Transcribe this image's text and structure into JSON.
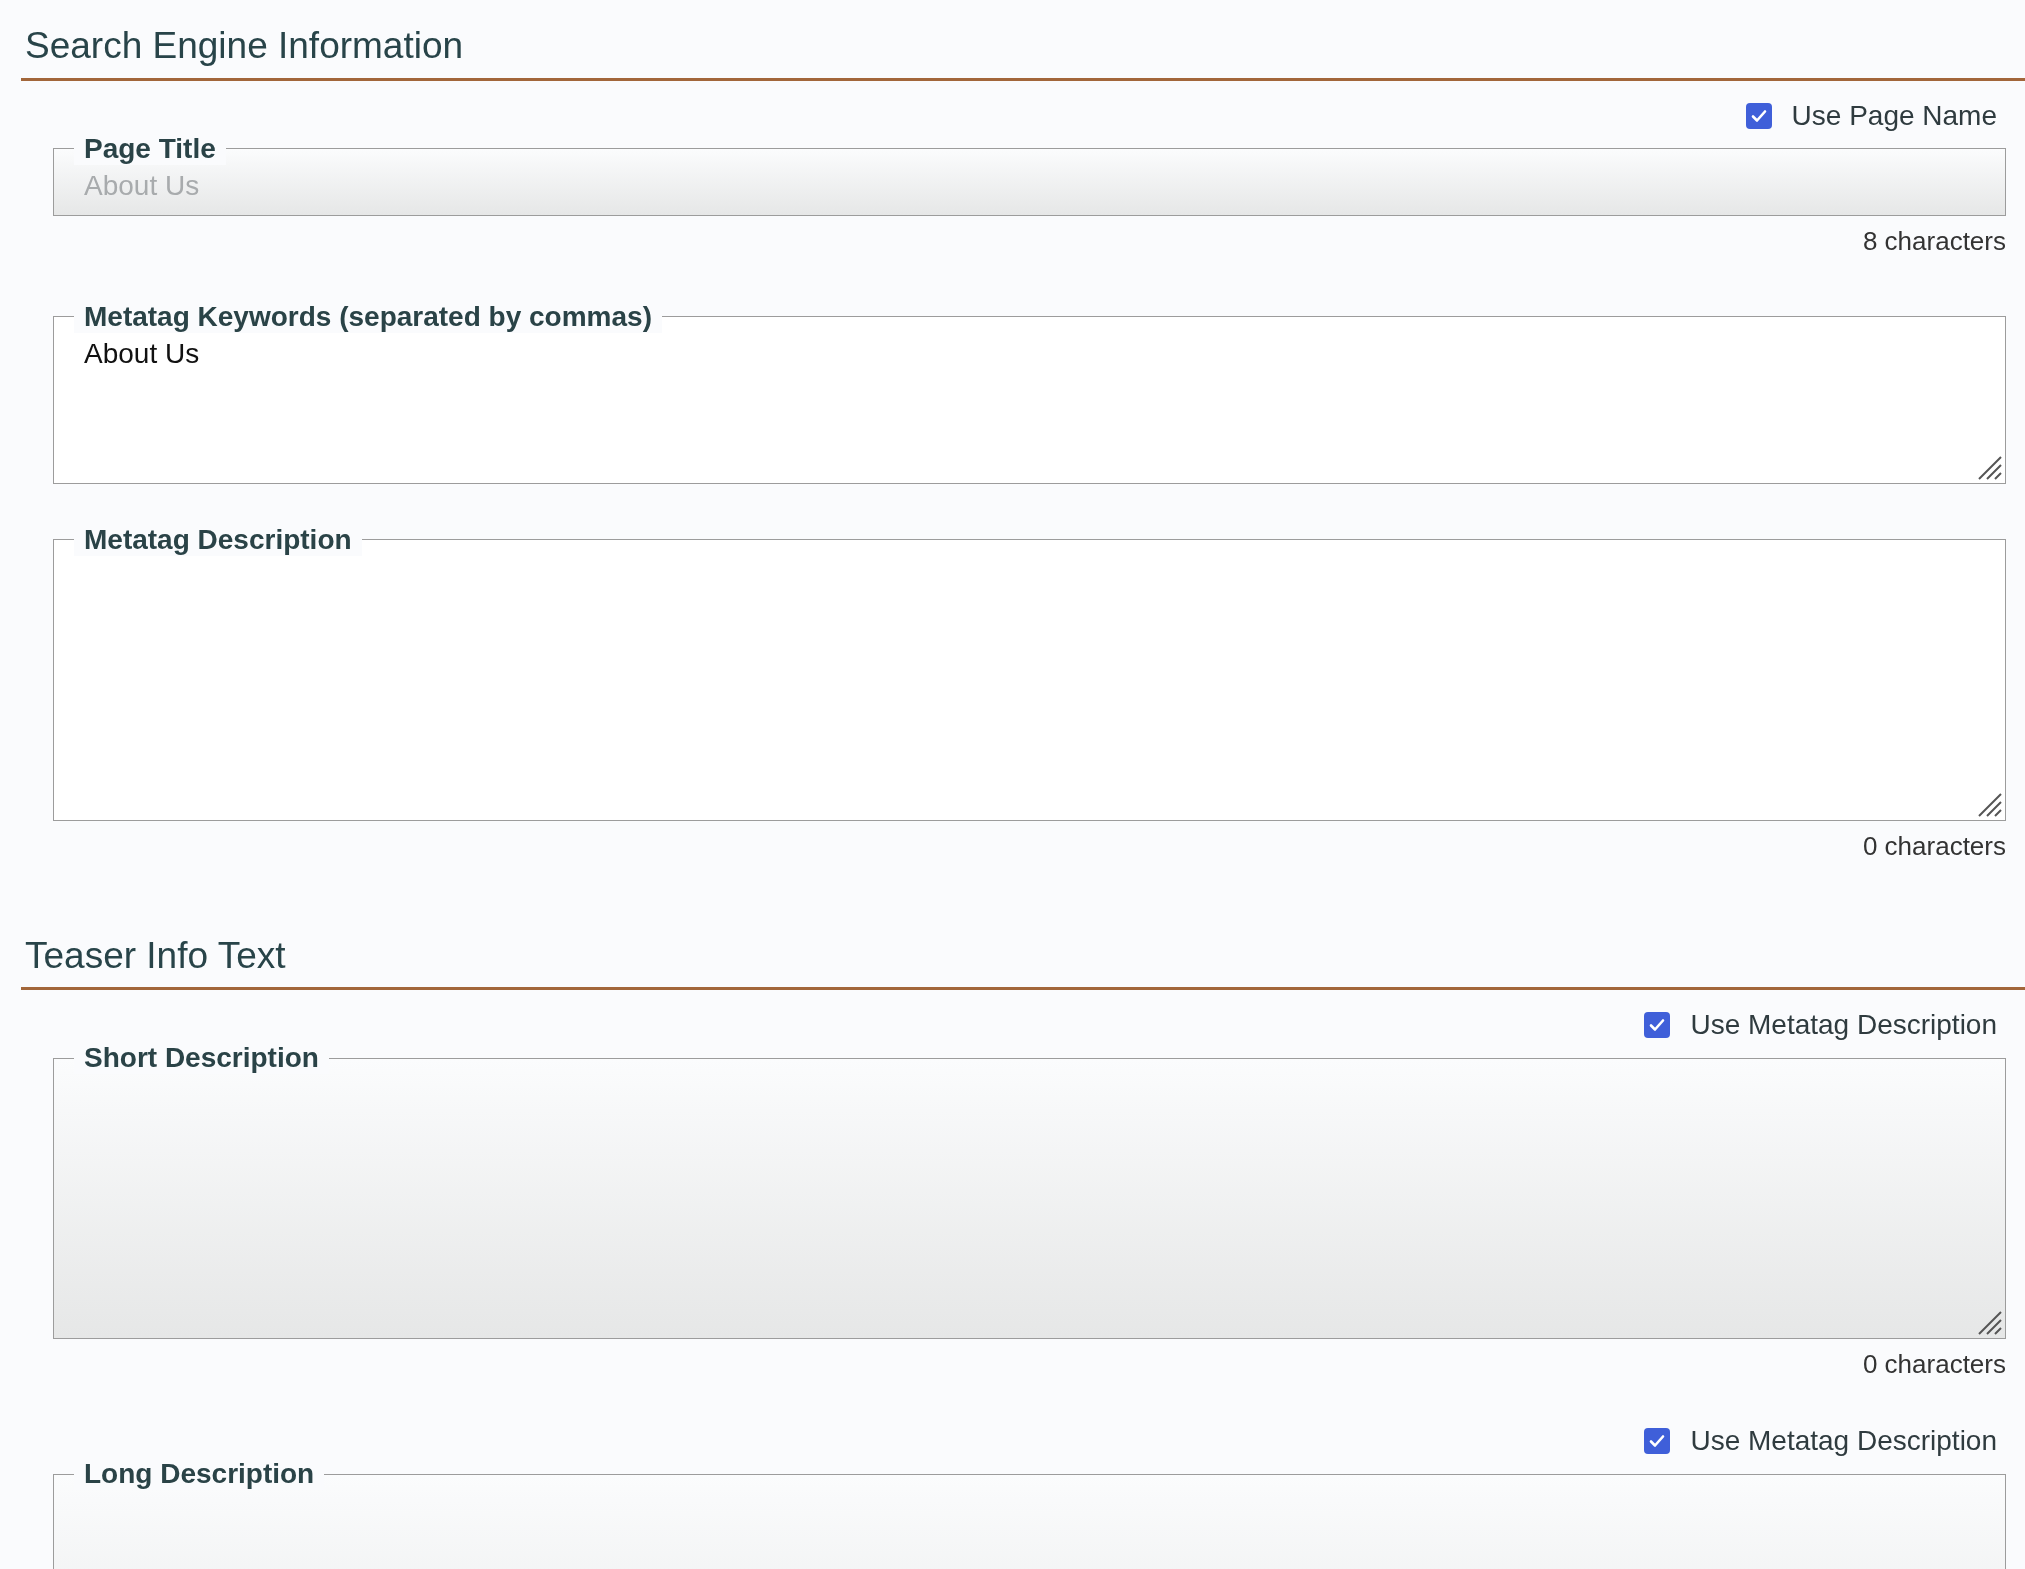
{
  "sections": [
    {
      "title": "Search Engine Information",
      "fields": [
        {
          "kind": "input",
          "label": "Page Title",
          "value": "About Us",
          "disabled": true,
          "checkbox": {
            "label": "Use Page Name",
            "checked": true
          },
          "counter": "8 characters"
        },
        {
          "kind": "short-textarea",
          "label": "Metatag Keywords (separated by commas)",
          "value": "About Us",
          "disabled": false
        },
        {
          "kind": "textarea",
          "label": "Metatag Description",
          "disabled": false,
          "counter": "0 characters"
        }
      ]
    },
    {
      "title": "Teaser Info Text",
      "fields": [
        {
          "kind": "textarea",
          "label": "Short Description",
          "disabled": true,
          "checkbox": {
            "label": "Use Metatag Description",
            "checked": true
          },
          "counter": "0 characters"
        },
        {
          "kind": "textarea",
          "label": "Long Description",
          "disabled": true,
          "checkbox": {
            "label": "Use Metatag Description",
            "checked": true
          }
        }
      ]
    }
  ]
}
